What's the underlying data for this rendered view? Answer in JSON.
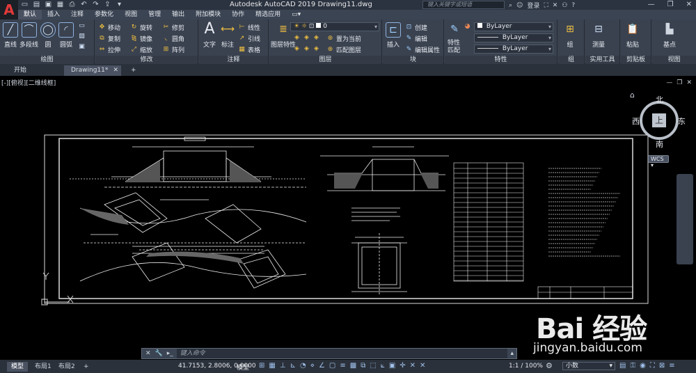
{
  "window": {
    "title": "Autodesk AutoCAD 2019    Drawing11.dwg",
    "search_placeholder": "键入关键字或短语",
    "login": "登录",
    "logo": "A"
  },
  "menu_tabs": [
    "默认",
    "插入",
    "注释",
    "参数化",
    "视图",
    "管理",
    "输出",
    "附加模块",
    "协作",
    "精选应用"
  ],
  "ribbon": {
    "draw": {
      "title": "绘图",
      "line": "直线",
      "polyline": "多段线",
      "circle": "圆",
      "arc": "圆弧"
    },
    "modify": {
      "title": "修改",
      "rows": [
        [
          "移动",
          "旋转",
          "修剪"
        ],
        [
          "复制",
          "镜像",
          "圆角"
        ],
        [
          "拉伸",
          "缩放",
          "阵列"
        ]
      ]
    },
    "annotation": {
      "title": "注释",
      "text": "文字",
      "dimension": "标注",
      "linear": "线性",
      "leader": "引线",
      "table": "表格"
    },
    "layers": {
      "title": "图层",
      "properties": "图层特性",
      "layer_value": "0",
      "set_current": "置为当前",
      "match": "匹配图层"
    },
    "block": {
      "title": "块",
      "insert": "插入",
      "create": "创建",
      "edit": "编辑",
      "edit_attr": "编辑属性"
    },
    "properties": {
      "title": "特性",
      "match": "特性匹配",
      "color": "ByLayer",
      "linetype": "ByLayer",
      "lineweight": "ByLayer"
    },
    "groups": {
      "title": "组",
      "group": "组"
    },
    "utilities": {
      "title": "实用工具",
      "measure": "测量"
    },
    "clipboard": {
      "title": "剪贴板",
      "paste": "粘贴"
    },
    "view": {
      "title": "视图",
      "base": "基点"
    }
  },
  "file_tabs": {
    "start": "开始",
    "drawing": "Drawing11*"
  },
  "viewport": {
    "label": "[-][俯视][二维线框]"
  },
  "viewcube": {
    "north": "北",
    "south": "南",
    "west": "西",
    "east": "东",
    "face": "上",
    "wcs": "WCS"
  },
  "command": {
    "placeholder": "键入命令"
  },
  "status": {
    "layouts": [
      "模型",
      "布局1",
      "布局2"
    ],
    "coords": "41.7153, 2.8006, 0.0000",
    "space": "模型",
    "scale": "1:1 / 100%",
    "units": "小数"
  },
  "watermark": {
    "logo": "Bai 经验",
    "url": "jingyan.baidu.com"
  }
}
